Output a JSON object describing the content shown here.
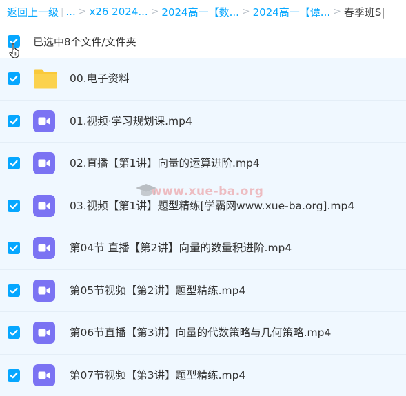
{
  "breadcrumb": {
    "back_label": "返回上一级",
    "pipe": "|",
    "ellipsis": "...",
    "separator": ">",
    "items": [
      "x26 2024...",
      "2024高一【数...",
      "2024高一【谭..."
    ],
    "current": "春季班S|"
  },
  "selection": {
    "label": "已选中8个文件/文件夹",
    "checked": true
  },
  "files": [
    {
      "name": "00.电子资料",
      "type": "folder",
      "checked": true
    },
    {
      "name": "01.视频·学习规划课.mp4",
      "type": "video",
      "checked": true
    },
    {
      "name": "02.直播【第1讲】向量的运算进阶.mp4",
      "type": "video",
      "checked": true
    },
    {
      "name": "03.视频【第1讲】题型精练[学霸网www.xue-ba.org].mp4",
      "type": "video",
      "checked": true
    },
    {
      "name": "第04节 直播【第2讲】向量的数量积进阶.mp4",
      "type": "video",
      "checked": true
    },
    {
      "name": "第05节视频【第2讲】题型精练.mp4",
      "type": "video",
      "checked": true
    },
    {
      "name": "第06节直播【第3讲】向量的代数策略与几何策略.mp4",
      "type": "video",
      "checked": true
    },
    {
      "name": "第07节视频【第3讲】题型精练.mp4",
      "type": "video",
      "checked": true
    }
  ],
  "watermark": {
    "text": "www.xue-ba.org"
  },
  "colors": {
    "accent": "#06a7ff",
    "video_icon": "#7b73f3",
    "folder": "#f9c93a",
    "row_bg": "#f0f8ff"
  },
  "icons": {
    "checkbox": "check-icon",
    "folder": "folder-icon",
    "video": "video-camera-icon",
    "cursor": "hand-pointer-icon"
  }
}
